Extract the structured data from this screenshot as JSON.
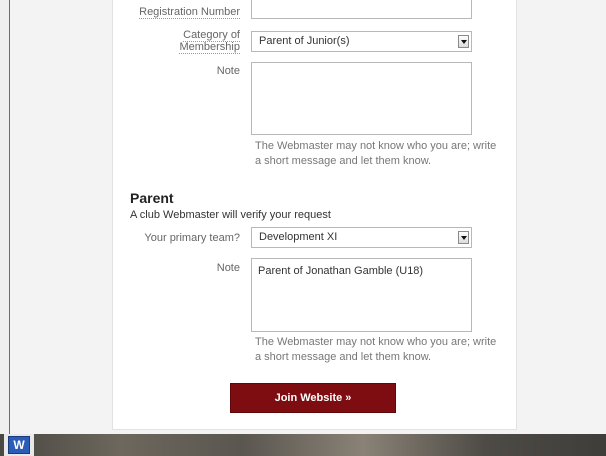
{
  "form": {
    "registration_label": "Registration Number",
    "category_label_line1": "Category of",
    "category_label_line2": "Membership",
    "category_value": "Parent of Junior(s)",
    "note_label": "Note",
    "note_value": "",
    "note_hint": "The Webmaster may not know who you are; write a short message and let them know."
  },
  "parent": {
    "heading": "Parent",
    "subtext": "A club Webmaster will verify your request",
    "team_label": "Your primary team?",
    "team_value": "Development XI",
    "note_label": "Note",
    "note_value": "Parent of Jonathan Gamble (U18)",
    "note_hint": "The Webmaster may not know who you are; write a short message and let them know."
  },
  "join_button": "Join Website »",
  "taskbar": {
    "word_icon_label": "W"
  },
  "colors": {
    "button_bg": "#7d0d10",
    "panel_bg": "#ffffff",
    "page_bg": "#f3f3f3"
  }
}
